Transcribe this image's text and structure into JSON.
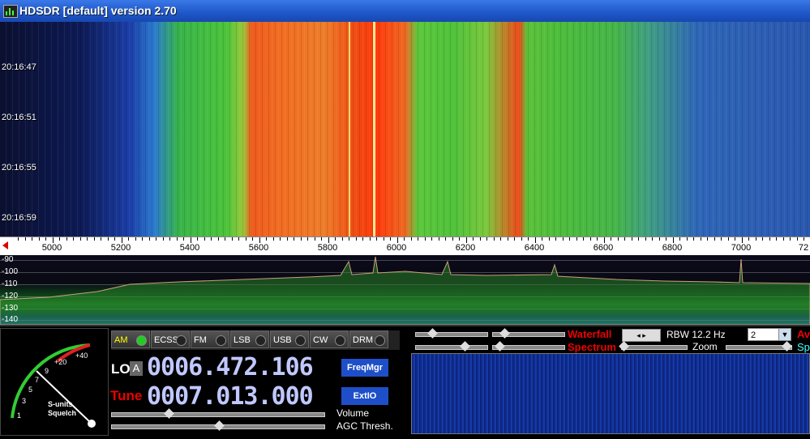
{
  "window": {
    "title": "HDSDR [default]  version 2.70",
    "icon": "app-icon"
  },
  "waterfall": {
    "timestamps": [
      "20:16:47",
      "20:16:51",
      "20:16:55",
      "20:16:59"
    ]
  },
  "frequency_axis": {
    "labels": [
      "5000",
      "5200",
      "5400",
      "5600",
      "5800",
      "6000",
      "6200",
      "6400",
      "6600",
      "6800",
      "7000",
      "72"
    ]
  },
  "spectrum": {
    "db_labels": [
      "-90",
      "-100",
      "-110",
      "-120",
      "-130",
      "-140"
    ]
  },
  "modes": [
    {
      "label": "AM",
      "active": true
    },
    {
      "label": "ECSS",
      "active": false
    },
    {
      "label": "FM",
      "active": false
    },
    {
      "label": "LSB",
      "active": false
    },
    {
      "label": "USB",
      "active": false
    },
    {
      "label": "CW",
      "active": false
    },
    {
      "label": "DRM",
      "active": false
    }
  ],
  "lo": {
    "label": "LO",
    "vfo": "A",
    "frequency": "0006.472.106"
  },
  "tune": {
    "label": "Tune",
    "frequency": "0007.013.000"
  },
  "buttons": {
    "freqmgr": "FreqMgr",
    "extio": "ExtIO"
  },
  "sliders": {
    "volume_label": "Volume",
    "agc_label": "AGC Thresh.",
    "volume_level": 0.27,
    "agc_level": 0.5
  },
  "smeter": {
    "scale": [
      "1",
      "3",
      "5",
      "7",
      "9",
      "+20",
      "+40"
    ],
    "label1": "S-units",
    "label2": "Squelch"
  },
  "display_controls": {
    "waterfall_label": "Waterfall",
    "spectrum_label": "Spectrum",
    "zoom_label": "Zoom",
    "rbw": "RBW 12.2 Hz",
    "avg_value": "2",
    "cut_label_red": "Av",
    "cut_label_cyan": "Sp"
  },
  "colors": {
    "accent_red": "#e00000",
    "display_blue": "#c0c8ff",
    "titlebar": "#1e56c8"
  }
}
